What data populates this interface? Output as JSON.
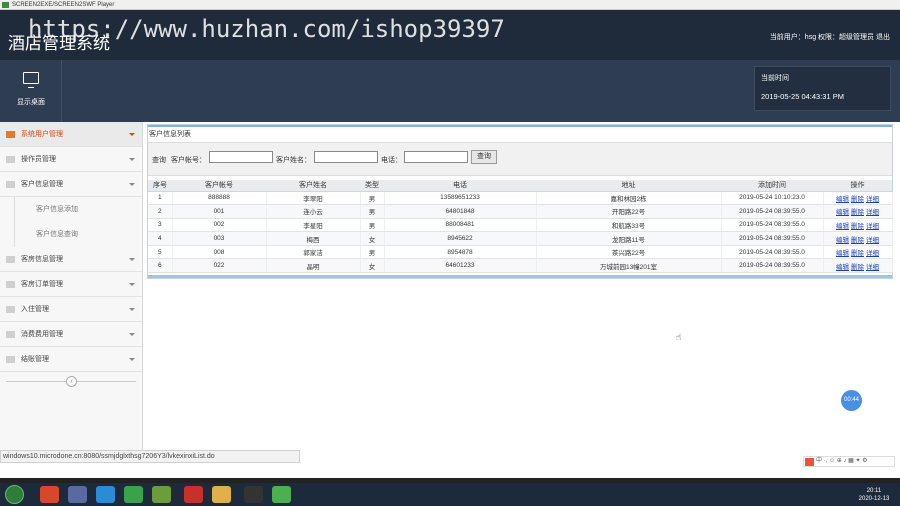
{
  "window": {
    "title": "SCREEN2EXE/SCREEN2SWF Player"
  },
  "header": {
    "system_title": "酒店管理系统",
    "watermark": "https://www.huzhan.com/ishop39397",
    "user_bar": "当前用户：hsg 权限：超级管理员 退出",
    "desk_button_label": "显示桌面",
    "time_label": "当前时间",
    "time_value": "2019-05-25 04:43:31 PM"
  },
  "sidebar": {
    "items": [
      {
        "label": "系统用户管理",
        "active": true
      },
      {
        "label": "操作员管理"
      },
      {
        "label": "客户信息管理"
      }
    ],
    "sub_items": [
      {
        "label": "客户信息添加"
      },
      {
        "label": "客户信息查询"
      }
    ],
    "items_after": [
      {
        "label": "客房信息管理"
      },
      {
        "label": "客房订单管理"
      },
      {
        "label": "入住管理"
      },
      {
        "label": "消费费用管理"
      },
      {
        "label": "结账管理"
      }
    ],
    "collapse_glyph": "‹"
  },
  "main": {
    "panel_title": "客户信息列表",
    "search": {
      "query_label": "查询",
      "account_label": "客户帐号：",
      "name_label": "客户姓名：",
      "phone_label": "电话：",
      "account_value": "",
      "name_value": "",
      "phone_value": "",
      "button_label": "查询"
    },
    "table": {
      "columns": [
        "序号",
        "客户帐号",
        "客户姓名",
        "类型",
        "电话",
        "地址",
        "添加时间",
        "操作"
      ],
      "rows": [
        [
          "1",
          "888888",
          "李翠阳",
          "男",
          "13589651233",
          "嘉和林园2栋",
          "2019-05-24 10:10:23.0"
        ],
        [
          "2",
          "001",
          "连小云",
          "男",
          "64801848",
          "开阳路22号",
          "2019-05-24 08:39:55.0"
        ],
        [
          "3",
          "002",
          "李星阳",
          "男",
          "88008481",
          "和航路33号",
          "2019-05-24 08:39:55.0"
        ],
        [
          "4",
          "003",
          "梅西",
          "女",
          "8945622",
          "龙阳路11号",
          "2019-05-24 08:39:55.0"
        ],
        [
          "5",
          "008",
          "郭家洁",
          "男",
          "8954878",
          "茶兴路22号",
          "2019-05-24 08:39:55.0"
        ],
        [
          "6",
          "022",
          "晶明",
          "女",
          "64601233",
          "万城前园13幢201室",
          "2019-05-24 08:39:55.0"
        ]
      ],
      "op_edit": "编辑",
      "op_delete": "删除",
      "op_detail": "详细"
    }
  },
  "status_url": "windows10.microdone.cn:8080/ssmjdglxthsg7206Y3/lvkexinxiList.do",
  "bubble_time": "00:44",
  "ime_text": "中 ·, ☺ ⊕ ♪ ▦ ✦ ⚙",
  "taskbar": {
    "clock_time": "20:11",
    "clock_date": "2020-12-13"
  }
}
